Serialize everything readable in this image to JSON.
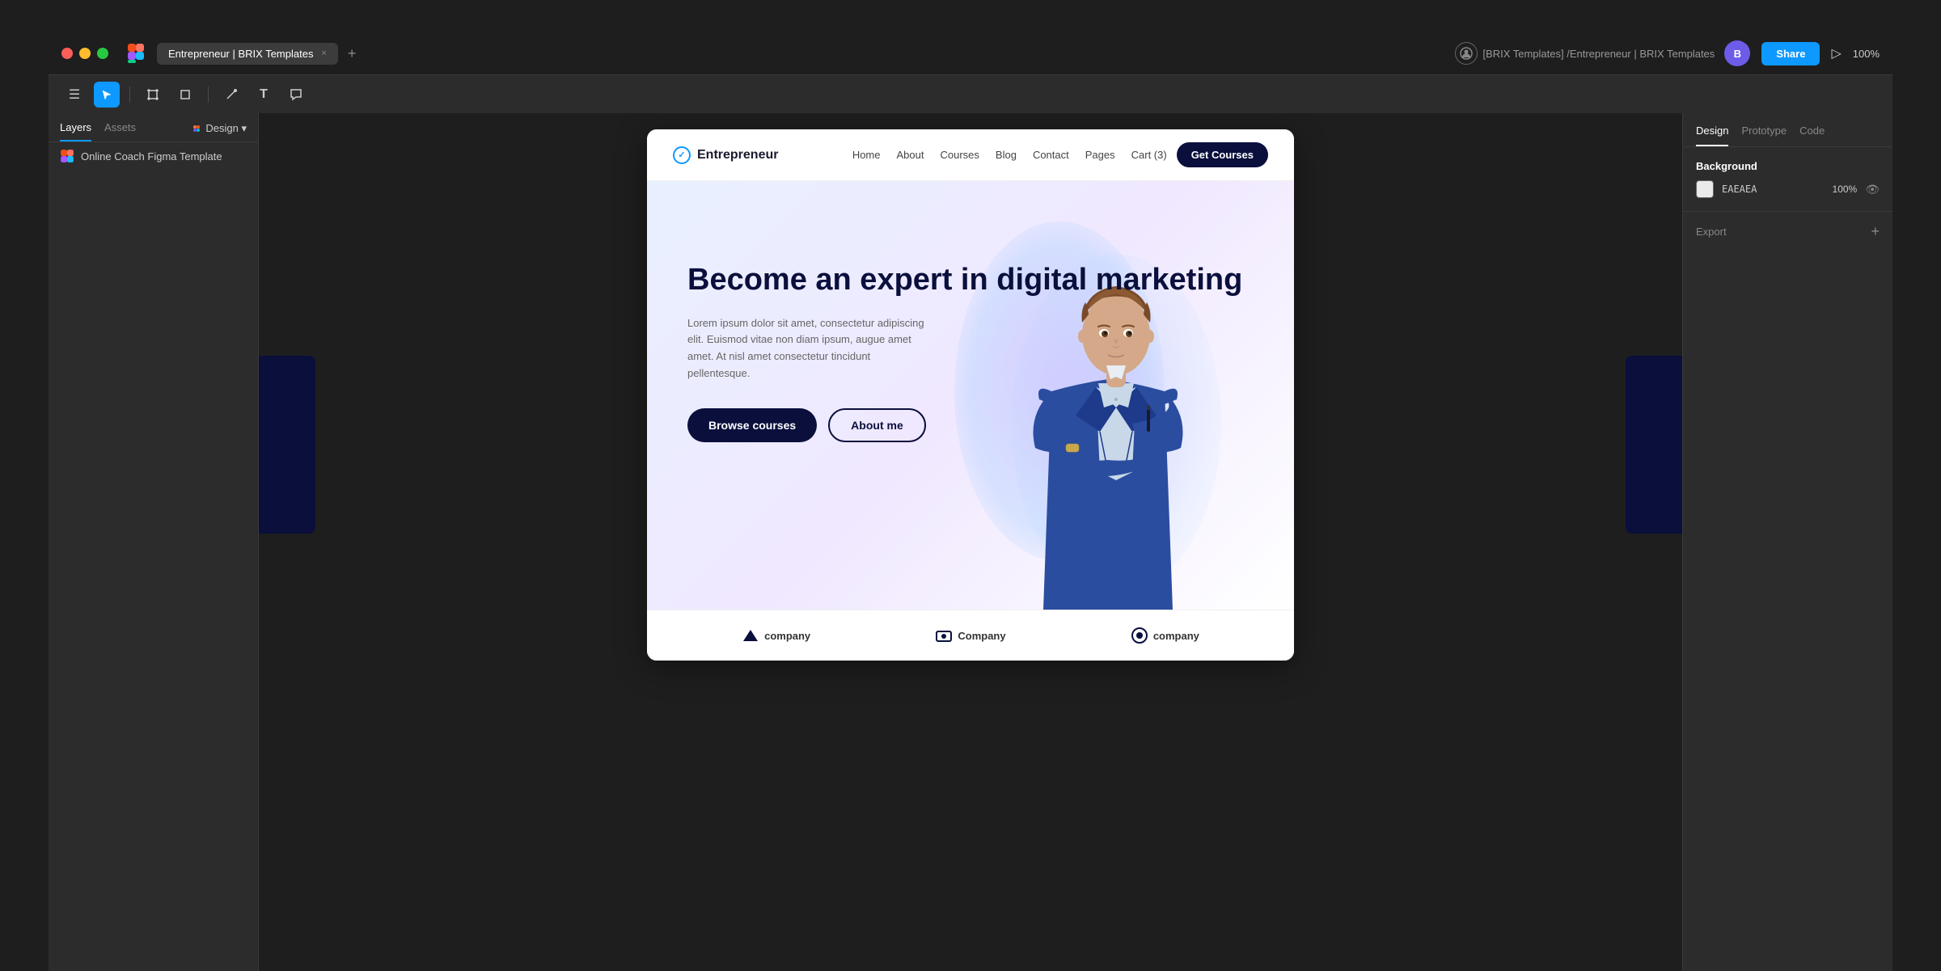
{
  "window": {
    "title": "Entrepreneur | BRIX Templates",
    "tab_close": "×",
    "tab_add": "+"
  },
  "toolbar": {
    "breadcrumb": "[BRIX Templates] /Entrepreneur | BRIX Templates",
    "share_label": "Share",
    "zoom_label": "100%"
  },
  "left_panel": {
    "tabs": [
      {
        "label": "Layers",
        "active": true
      },
      {
        "label": "Assets",
        "active": false
      }
    ],
    "design_label": "Design ▾",
    "layer_item": "Online Coach Figma Template"
  },
  "site": {
    "logo_text": "Entrepreneur",
    "nav_links": [
      "Home",
      "About",
      "Courses",
      "Blog",
      "Contact",
      "Pages"
    ],
    "cart_text": "Cart (3)",
    "get_courses": "Get Courses",
    "hero_title": "Become an expert in digital marketing",
    "hero_subtitle": "Lorem ipsum dolor sit amet, consectetur adipiscing elit. Euismod vitae non diam ipsum, augue amet amet. At nisl amet consectetur tincidunt pellentesque.",
    "browse_courses": "Browse courses",
    "about_me": "About me",
    "company_logos": [
      "company",
      "Company",
      "company"
    ]
  },
  "right_panel": {
    "tabs": [
      "Design",
      "Prototype",
      "Code"
    ],
    "active_tab": "Design",
    "background_label": "Background",
    "color_hex": "EAEAEA",
    "opacity": "100%",
    "export_label": "Export"
  }
}
